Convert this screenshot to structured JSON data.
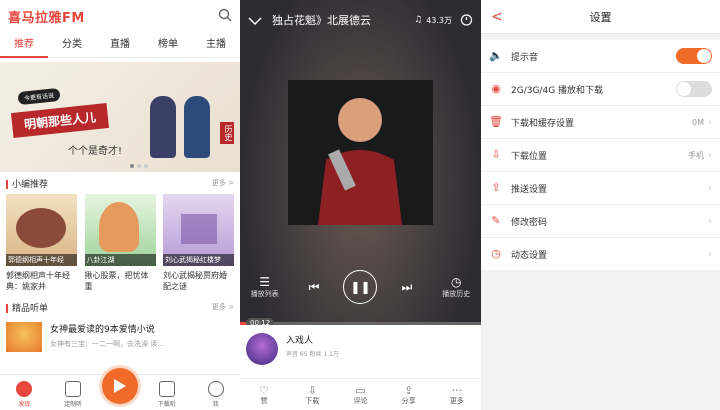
{
  "app": {
    "logo": "喜马拉雅FM",
    "tabs": [
      "推荐",
      "分类",
      "直播",
      "榜单",
      "主播"
    ],
    "banner": {
      "tag": "今更有话说",
      "title": "明朝那些人儿",
      "subtitle": "个个是奇才!",
      "side_label": "历史"
    },
    "editor_section": {
      "title": "小编推荐",
      "more": "更多 >"
    },
    "cards": [
      {
        "cover_label": "郭德纲相声十年经",
        "title": "郭德纲相声十年经典：姚家井"
      },
      {
        "cover_label": "八卦江湖",
        "title": "揪心股票，把忧体重"
      },
      {
        "cover_label": "刘心武揭秘红楼梦",
        "title": "刘心武揭秘贾府婚配之谜"
      }
    ],
    "boutique_section": {
      "title": "精品听单",
      "more": "更多 >"
    },
    "list_item": {
      "title": "女神最爱读的9本爱情小说",
      "subtitle": "女神有三宝：一二一啊，去洗澡 读..."
    },
    "bottom_nav": [
      "发现",
      "定制听",
      "",
      "下载听",
      "我"
    ]
  },
  "player": {
    "title": "独占花魁》北展德云",
    "count": "43.3万",
    "controls": {
      "playlist": "播放列表",
      "history": "播放历史"
    },
    "progress": 0.05,
    "time": "00:12",
    "anchor": {
      "name": "入戏人",
      "stats": "声音 65  粉丝 1.1万"
    },
    "actions": [
      "赞",
      "下载",
      "评论",
      "分享",
      "更多"
    ]
  },
  "settings": {
    "title": "设置",
    "back": "<",
    "rows": [
      {
        "icon": "speaker-icon",
        "label": "提示音",
        "type": "toggle",
        "on": true
      },
      {
        "icon": "network-icon",
        "label": "2G/3G/4G 播放和下载",
        "type": "toggle",
        "on": false
      },
      {
        "icon": "trash-icon",
        "label": "下载和缓存设置",
        "type": "value",
        "value": "0M"
      },
      {
        "icon": "download-icon",
        "label": "下载位置",
        "type": "value",
        "value": "手机"
      },
      {
        "icon": "share-icon",
        "label": "推送设置",
        "type": "arrow"
      },
      {
        "icon": "edit-icon",
        "label": "修改密码",
        "type": "arrow"
      },
      {
        "icon": "clock-icon",
        "label": "动态设置",
        "type": "arrow"
      }
    ]
  },
  "colors": {
    "accent": "#e8473d",
    "orange": "#f06b2a"
  }
}
